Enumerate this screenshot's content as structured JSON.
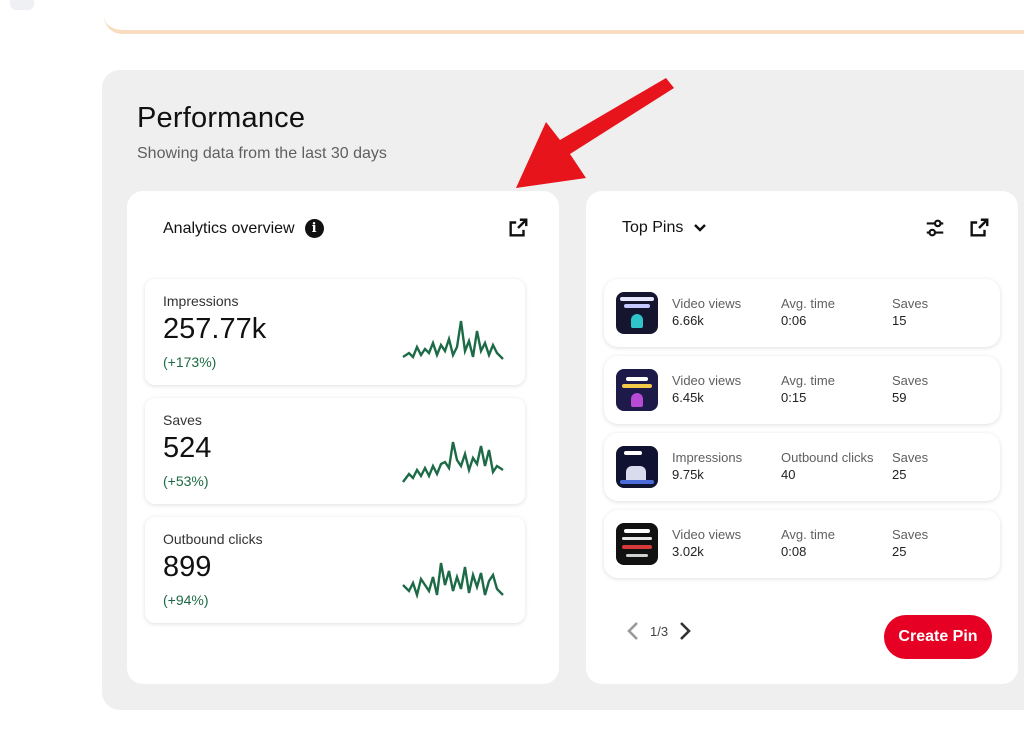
{
  "performance": {
    "title": "Performance",
    "subtitle": "Showing data from the last 30 days"
  },
  "overview": {
    "title": "Analytics overview",
    "info_icon": "info-icon",
    "open_icon": "external-link-icon",
    "metrics": [
      {
        "label": "Impressions",
        "value": "257.77k",
        "change": "(+173%)"
      },
      {
        "label": "Saves",
        "value": "524",
        "change": "(+53%)"
      },
      {
        "label": "Outbound clicks",
        "value": "899",
        "change": "(+94%)"
      }
    ],
    "sparkline_color": "#1c6b46"
  },
  "top_pins": {
    "title": "Top Pins",
    "dropdown_icon": "chevron-down-icon",
    "filter_icon": "sliders-icon",
    "open_icon": "external-link-icon",
    "rows": [
      {
        "s1_label": "Video views",
        "s1_value": "6.66k",
        "s2_label": "Avg. time",
        "s2_value": "0:06",
        "s3_label": "Saves",
        "s3_value": "15"
      },
      {
        "s1_label": "Video views",
        "s1_value": "6.45k",
        "s2_label": "Avg. time",
        "s2_value": "0:15",
        "s3_label": "Saves",
        "s3_value": "59"
      },
      {
        "s1_label": "Impressions",
        "s1_value": "9.75k",
        "s2_label": "Outbound clicks",
        "s2_value": "40",
        "s3_label": "Saves",
        "s3_value": "25"
      },
      {
        "s1_label": "Video views",
        "s1_value": "3.02k",
        "s2_label": "Avg. time",
        "s2_value": "0:08",
        "s3_label": "Saves",
        "s3_value": "25"
      }
    ],
    "pager": {
      "text": "1/3",
      "prev_icon": "chevron-left-icon",
      "next_icon": "chevron-right-icon"
    },
    "create_button": "Create Pin"
  },
  "colors": {
    "accent": "#e60023",
    "positive": "#1c6b46",
    "annotation_arrow": "#e8141c"
  }
}
